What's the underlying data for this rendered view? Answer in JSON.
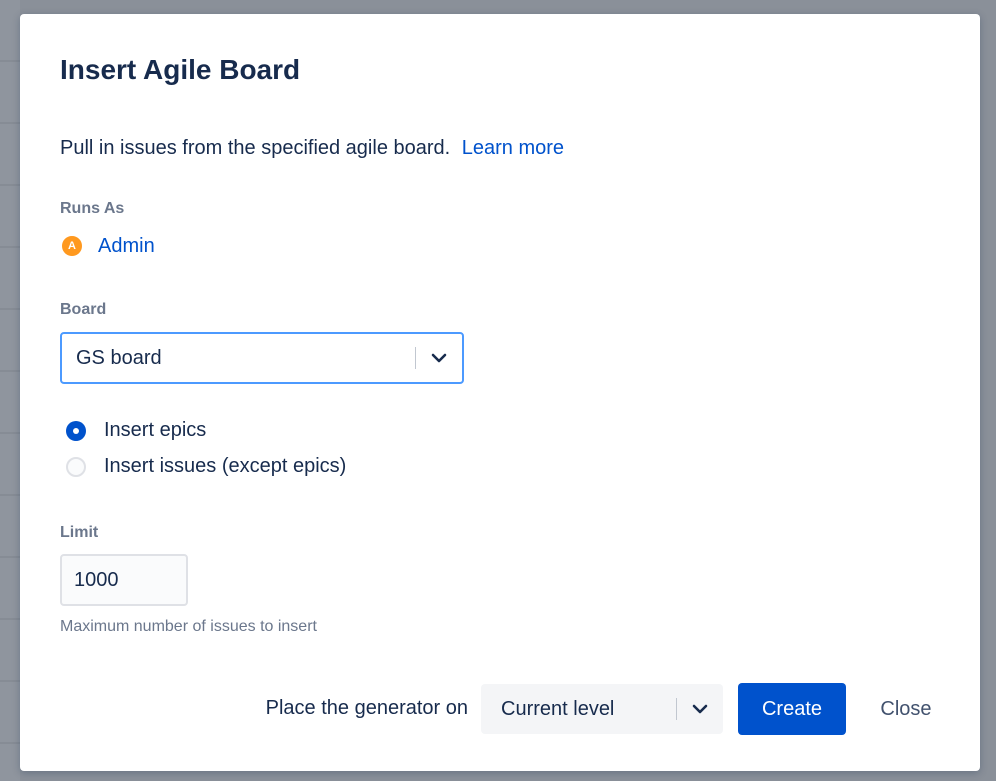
{
  "dialog": {
    "title": "Insert Agile Board",
    "description": "Pull in issues from the specified agile board.",
    "learn_more": "Learn more"
  },
  "runs_as": {
    "label": "Runs As",
    "avatar_initial": "A",
    "user": "Admin",
    "avatar_color": "#ff991f"
  },
  "board": {
    "label": "Board",
    "selected": "GS board"
  },
  "insert_mode": {
    "options": [
      {
        "label": "Insert epics",
        "checked": true
      },
      {
        "label": "Insert issues (except epics)",
        "checked": false
      }
    ]
  },
  "limit": {
    "label": "Limit",
    "value": "1000",
    "helper": "Maximum number of issues to insert"
  },
  "footer": {
    "place_label": "Place the generator on",
    "place_selected": "Current level",
    "create_label": "Create",
    "close_label": "Close"
  },
  "colors": {
    "primary": "#0052cc",
    "text": "#172b4d",
    "subtle": "#6b778c",
    "focus_border": "#4c9aff"
  },
  "icons": {
    "board_select": "chevron-down-icon",
    "place_select": "chevron-down-icon"
  }
}
